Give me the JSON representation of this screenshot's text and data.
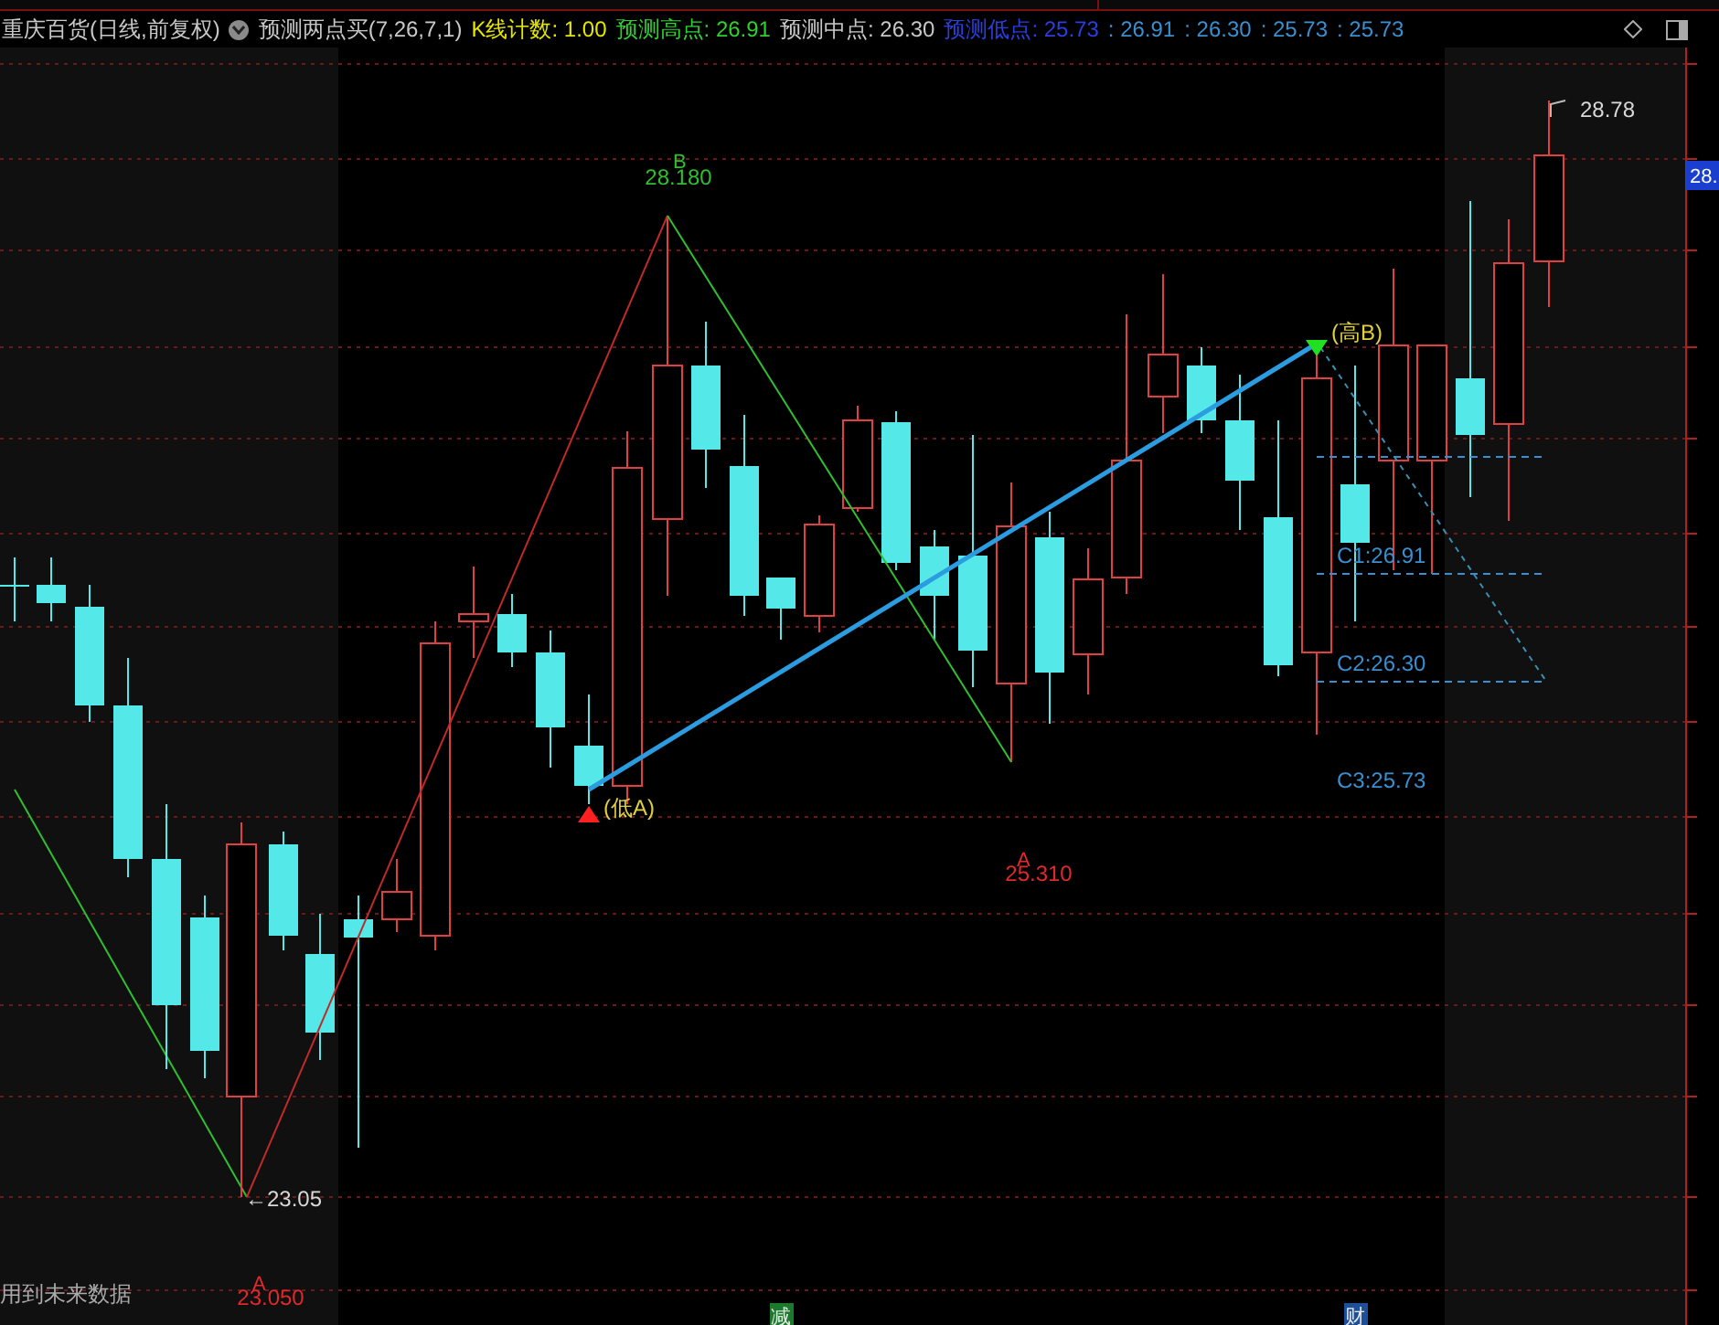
{
  "header": {
    "title": "重庆百货(日线,前复权)",
    "indicator": "预测两点买(7,26,7,1)",
    "values": [
      {
        "kind": "count",
        "label": "K线计数:",
        "value": "1.00"
      },
      {
        "kind": "high",
        "label": "预测高点:",
        "value": "26.91"
      },
      {
        "kind": "mid",
        "label": "预测中点:",
        "value": "26.30"
      },
      {
        "kind": "low",
        "label": "预测低点:",
        "value": "25.73"
      }
    ],
    "extra": [
      ": 26.91",
      ": 26.30",
      ": 25.73",
      ": 25.73"
    ]
  },
  "chart": {
    "pivots": [
      {
        "letter": "B",
        "value": "28.180",
        "color": "#2fbf2f"
      },
      {
        "letter": "A",
        "value": "25.310",
        "color": "#e02a2a"
      },
      {
        "letter": "A",
        "value": "23.050",
        "color": "#e02a2a"
      }
    ],
    "points": [
      {
        "text": "(低A)"
      },
      {
        "text": "(高B)"
      }
    ],
    "levels": [
      "C1:26.91",
      "C2:26.30",
      "C3:25.73"
    ],
    "price_tags": [
      "←23.05",
      "28.78"
    ],
    "axis_tag": "28.",
    "warning": "用到未来数据",
    "events": [
      {
        "kind": "reduce",
        "text": "减"
      },
      {
        "kind": "finance",
        "text": "财"
      }
    ]
  }
}
